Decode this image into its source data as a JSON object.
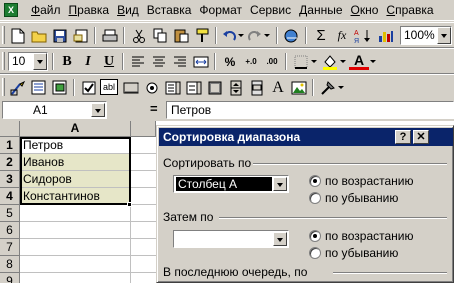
{
  "menu": {
    "items": [
      {
        "label": "Файл",
        "accel": "Ф",
        "rest": "айл"
      },
      {
        "label": "Правка",
        "accel": "П",
        "rest": "равка"
      },
      {
        "label": "Вид",
        "accel": "В",
        "rest": "ид"
      },
      {
        "label": "Вставка",
        "accel": "",
        "rest": "Вставка"
      },
      {
        "label": "Формат",
        "accel": "",
        "rest": "Формат"
      },
      {
        "label": "Сервис",
        "accel": "",
        "rest": "Сервис"
      },
      {
        "label": "Данные",
        "accel": "Д",
        "rest": "анные"
      },
      {
        "label": "Окно",
        "accel": "О",
        "rest": "кно"
      },
      {
        "label": "Справка",
        "accel": "С",
        "rest": "правка"
      }
    ]
  },
  "toolbar_standard": {
    "sigma": "Σ",
    "fx": "fx",
    "zoom": "100%"
  },
  "toolbar_format": {
    "font_size": "10",
    "bold": "B",
    "italic": "I",
    "underline": "U",
    "percent": "%",
    "inc_dec": "+.0",
    "dec_dec": ".00",
    "font_color": "A"
  },
  "toolbar_forms": {
    "label_tool": "A",
    "combo_tool": "abl"
  },
  "formula_bar": {
    "name_box": "A1",
    "equals": "=",
    "content": "Петров"
  },
  "sheet": {
    "column_headers": [
      "A"
    ],
    "row_headers": [
      "1",
      "2",
      "3",
      "4",
      "5",
      "6",
      "7",
      "8",
      "9"
    ],
    "cells": [
      "Петров",
      "Иванов",
      "Сидоров",
      "Константинов"
    ]
  },
  "dialog": {
    "title": "Сортировка диапазона",
    "help_btn": "?",
    "close_btn": "✕",
    "sort_by_label": "Сортировать по",
    "sort_by_value": "Столбец A",
    "then_by_label": "Затем по",
    "then_by_value": "",
    "last_by_label": "В последнюю очередь, по",
    "asc_label": "по возрастанию",
    "desc_label": "по убыванию"
  }
}
